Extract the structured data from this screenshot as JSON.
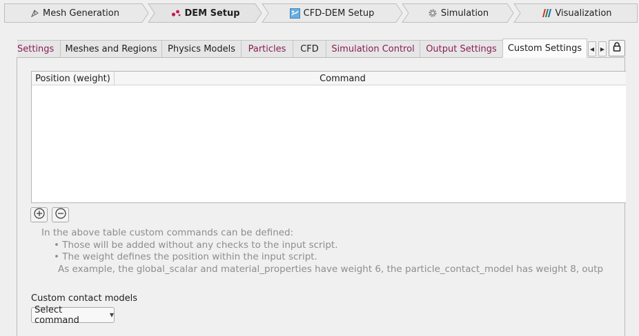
{
  "workflow": {
    "steps": [
      {
        "label": "Mesh Generation",
        "icon": "mesh-icon",
        "active": false
      },
      {
        "label": "DEM Setup",
        "icon": "dem-particles-icon",
        "active": true
      },
      {
        "label": "CFD-DEM Setup",
        "icon": "cfd-dem-icon",
        "active": false
      },
      {
        "label": "Simulation",
        "icon": "gear-icon",
        "active": false
      },
      {
        "label": "Visualization",
        "icon": "visualization-bars-icon",
        "active": false
      }
    ]
  },
  "tabs": [
    {
      "label": "Settings",
      "state": "warning"
    },
    {
      "label": "Meshes and Regions",
      "state": "normal"
    },
    {
      "label": "Physics Models",
      "state": "normal"
    },
    {
      "label": "Particles",
      "state": "warning"
    },
    {
      "label": "CFD",
      "state": "normal"
    },
    {
      "label": "Simulation Control",
      "state": "warning"
    },
    {
      "label": "Output Settings",
      "state": "warning"
    },
    {
      "label": "Custom Settings",
      "state": "active"
    }
  ],
  "tab_controls": {
    "scroll_left_icon": "triangle-left-icon",
    "scroll_right_icon": "triangle-right-icon",
    "lock_icon": "lock-icon"
  },
  "colors": {
    "warning_tab_text": "#8a1d55",
    "help_text": "#8d8d8d",
    "dem_icon": "#c2185b"
  },
  "custom_commands_table": {
    "columns": [
      "Position (weight)",
      "Command"
    ],
    "rows": []
  },
  "row_buttons": {
    "add_icon": "circle-plus-icon",
    "remove_icon": "circle-minus-icon"
  },
  "help": {
    "intro": "In the above table custom commands can be defined:",
    "bullets": [
      "• Those will be added without any checks to the input script.",
      "• The weight defines the position within the input script."
    ],
    "example": "As example, the global_scalar and material_properties have weight 6, the particle_contact_model has weight 8, outp"
  },
  "custom_contact_models": {
    "label": "Custom contact models",
    "select_label": "Select command"
  }
}
